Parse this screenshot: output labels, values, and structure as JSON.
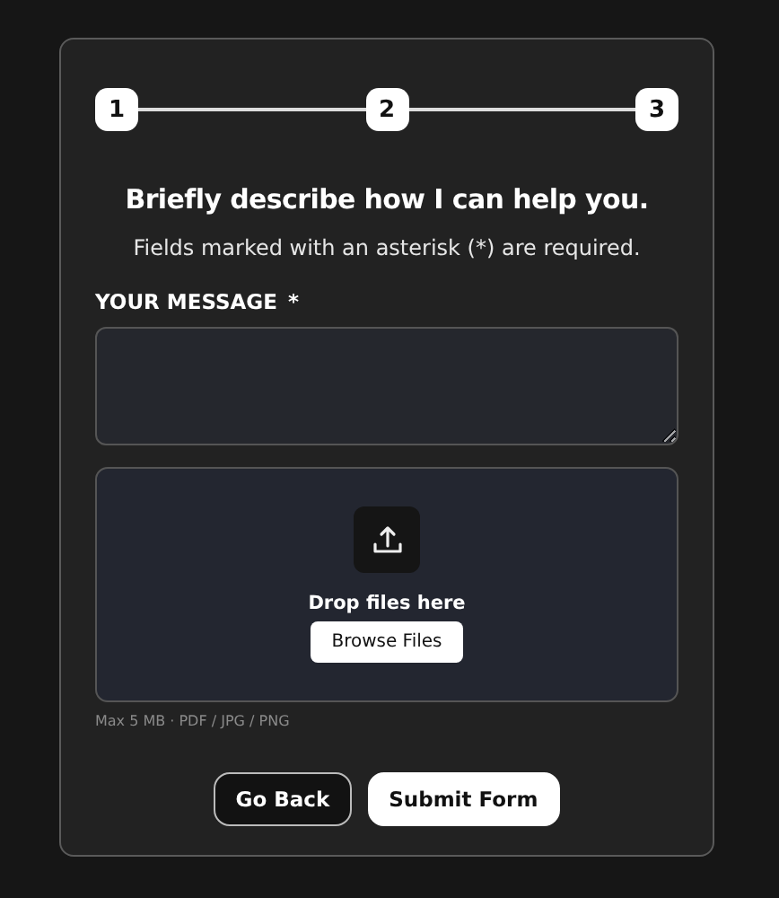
{
  "steps": [
    "1",
    "2",
    "3"
  ],
  "heading": "Briefly describe how I can help you.",
  "subtitle": "Fields marked with an asterisk (*) are required.",
  "message": {
    "label": "YOUR MESSAGE",
    "required_mark": "*"
  },
  "dropzone": {
    "text": "Drop files here",
    "button": "Browse Files",
    "hint": "Max 5 MB · PDF / JPG / PNG"
  },
  "buttons": [
    {
      "label": "Go Back",
      "kind": "secondary"
    },
    {
      "label": "Submit Form",
      "kind": "primary"
    }
  ]
}
